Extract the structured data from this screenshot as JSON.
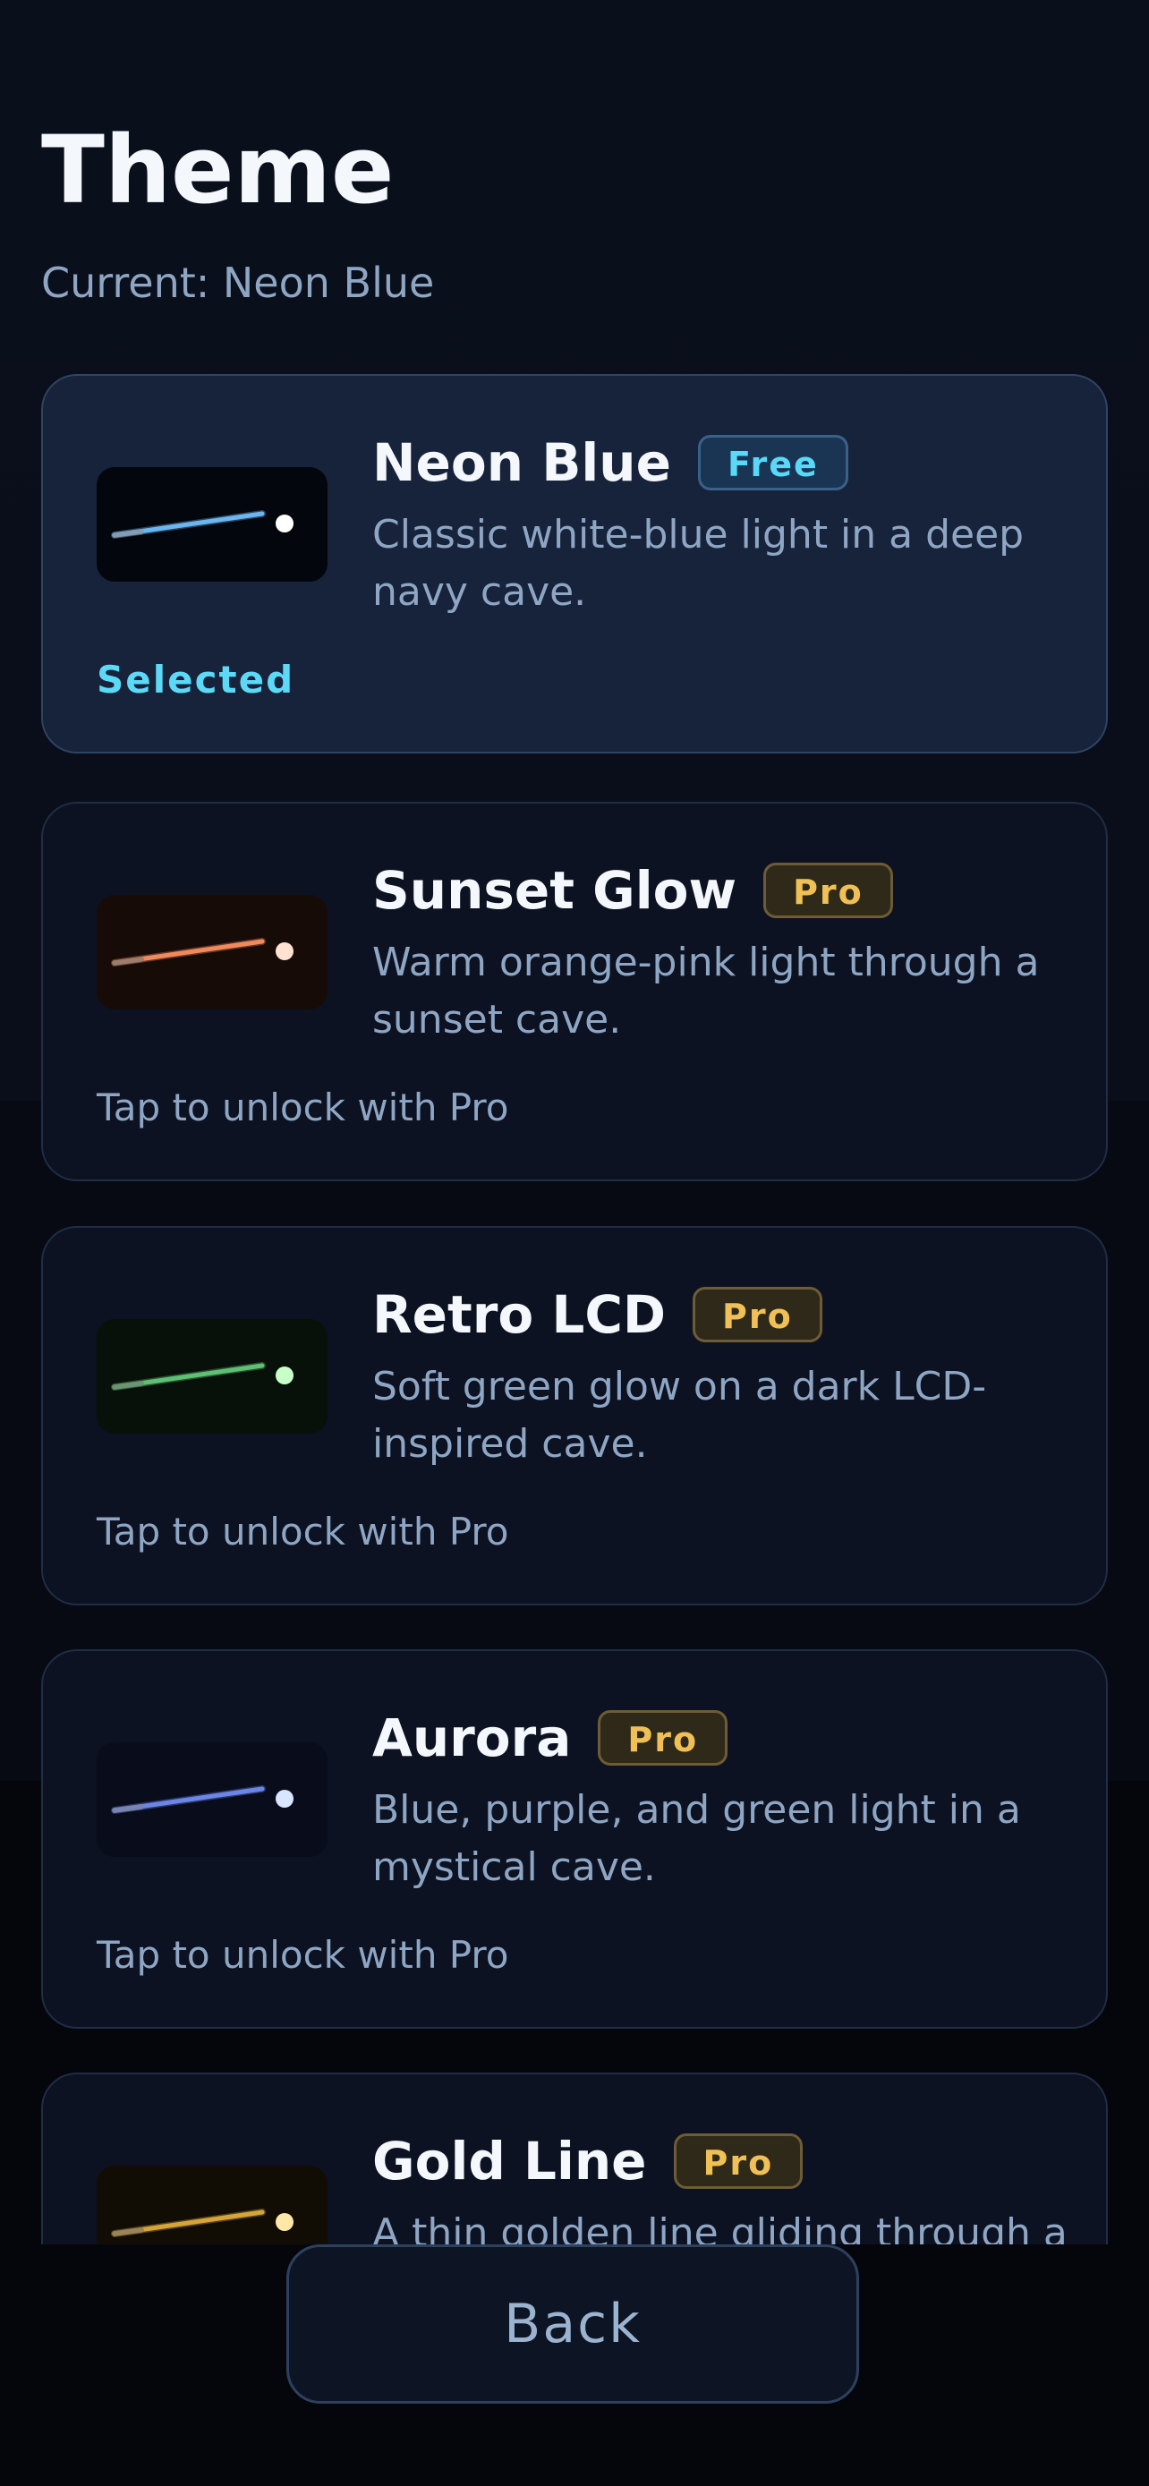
{
  "header": {
    "title": "Theme",
    "current": "Current: Neon Blue"
  },
  "themes": [
    {
      "name": "Neon Blue",
      "badge": "Free",
      "description": "Classic white-blue light in a deep navy cave.",
      "status": "Selected",
      "selected": true,
      "colors": {
        "bg": "#03060d",
        "line": "#6cb6ef",
        "dot": "#ffffff"
      }
    },
    {
      "name": "Sunset Glow",
      "badge": "Pro",
      "description": "Warm orange-pink light through a sunset cave.",
      "status": "Tap to unlock with Pro",
      "selected": false,
      "colors": {
        "bg": "#170b08",
        "line": "#f08a5d",
        "dot": "#ffe2cf"
      }
    },
    {
      "name": "Retro LCD",
      "badge": "Pro",
      "description": "Soft green glow on a dark LCD-inspired cave.",
      "status": "Tap to unlock with Pro",
      "selected": false,
      "colors": {
        "bg": "#07110a",
        "line": "#5fbf74",
        "dot": "#c8ffc8"
      }
    },
    {
      "name": "Aurora",
      "badge": "Pro",
      "description": "Blue, purple, and green light in a mystical cave.",
      "status": "Tap to unlock with Pro",
      "selected": false,
      "colors": {
        "bg": "#090c1b",
        "line": "#6c86e8",
        "dot": "#d8e6ff"
      }
    },
    {
      "name": "Gold Line",
      "badge": "Pro",
      "description": "A thin golden line gliding through a",
      "status": "",
      "selected": false,
      "colors": {
        "bg": "#110d05",
        "line": "#d6a53a",
        "dot": "#ffe7a8"
      }
    }
  ],
  "footer": {
    "back_label": "Back"
  }
}
